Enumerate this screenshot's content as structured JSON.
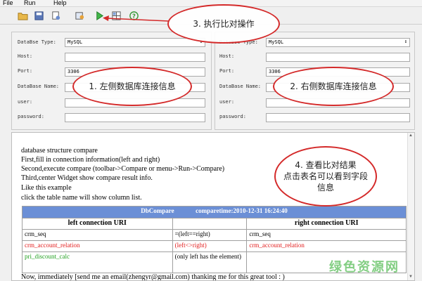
{
  "menu": {
    "file": "File",
    "run": "Run",
    "help": "Help"
  },
  "icons": {
    "open": "folder-open-icon",
    "save": "save-icon",
    "copy": "copy-icon",
    "export": "export-icon",
    "run": "run-compare-icon",
    "grid": "grid-icon",
    "help": "help-icon"
  },
  "left_panel": {
    "database_type_label": "DataBse Type:",
    "database_type_value": "MySQL",
    "host_label": "Host:",
    "host_value": "",
    "port_label": "Port:",
    "port_value": "3306",
    "database_name_label": "DataBase Name:",
    "database_name_value": "",
    "user_label": "user:",
    "user_value": "",
    "password_label": "password:",
    "password_value": ""
  },
  "right_panel": {
    "database_type_label": "DataBse Type:",
    "database_type_value": "MySQL",
    "host_label": "Host:",
    "host_value": "",
    "port_label": "Port:",
    "port_value": "3306",
    "database_name_label": "DataBase Name:",
    "database_name_value": "",
    "user_label": "user:",
    "user_value": "",
    "password_label": "password:",
    "password_value": ""
  },
  "result": {
    "lines": [
      "database structure compare",
      "First,fill in connection information(left and right)",
      "Second,execute compare (toolbar->Compare or menu->Run->Compare)",
      "Third,center Widget show compare result info.",
      "Like this example",
      "click the table name will show column list."
    ],
    "footer": "Now, immediately [send me an email(zhengyr@gmail.com) thanking me for this great tool : )"
  },
  "compare_table": {
    "banner_title": "DbCompare",
    "banner_time": "comparetime:2010-12-31 16:24:40",
    "left_header": "left connection URI",
    "right_header": "right connection URI",
    "rows": [
      {
        "left": "crm_seq",
        "mid": "=(left==right)",
        "right": "crm_seq",
        "color": "#000000"
      },
      {
        "left": "crm_account_relation",
        "mid": "(left<>right)",
        "right": "crm_account_relation",
        "color": "#e21c1c"
      },
      {
        "left": "pri_discount_calc",
        "mid": "(only left has the element)",
        "right": "",
        "color": "#22a020"
      }
    ]
  },
  "annotations": {
    "a1": "1. 左侧数据库连接信息",
    "a2": "2. 右侧数据库连接信息",
    "a3": "3. 执行比对操作",
    "a4_line1": "4. 查看比对结果",
    "a4_line2": "点击表名可以看到字段",
    "a4_line3": "信息"
  },
  "watermark": "绿色资源网",
  "colors": {
    "accent_red": "#d42a2a",
    "table_banner": "#6b8fd6",
    "diff_red": "#e21c1c",
    "only_left_green": "#22a020"
  }
}
